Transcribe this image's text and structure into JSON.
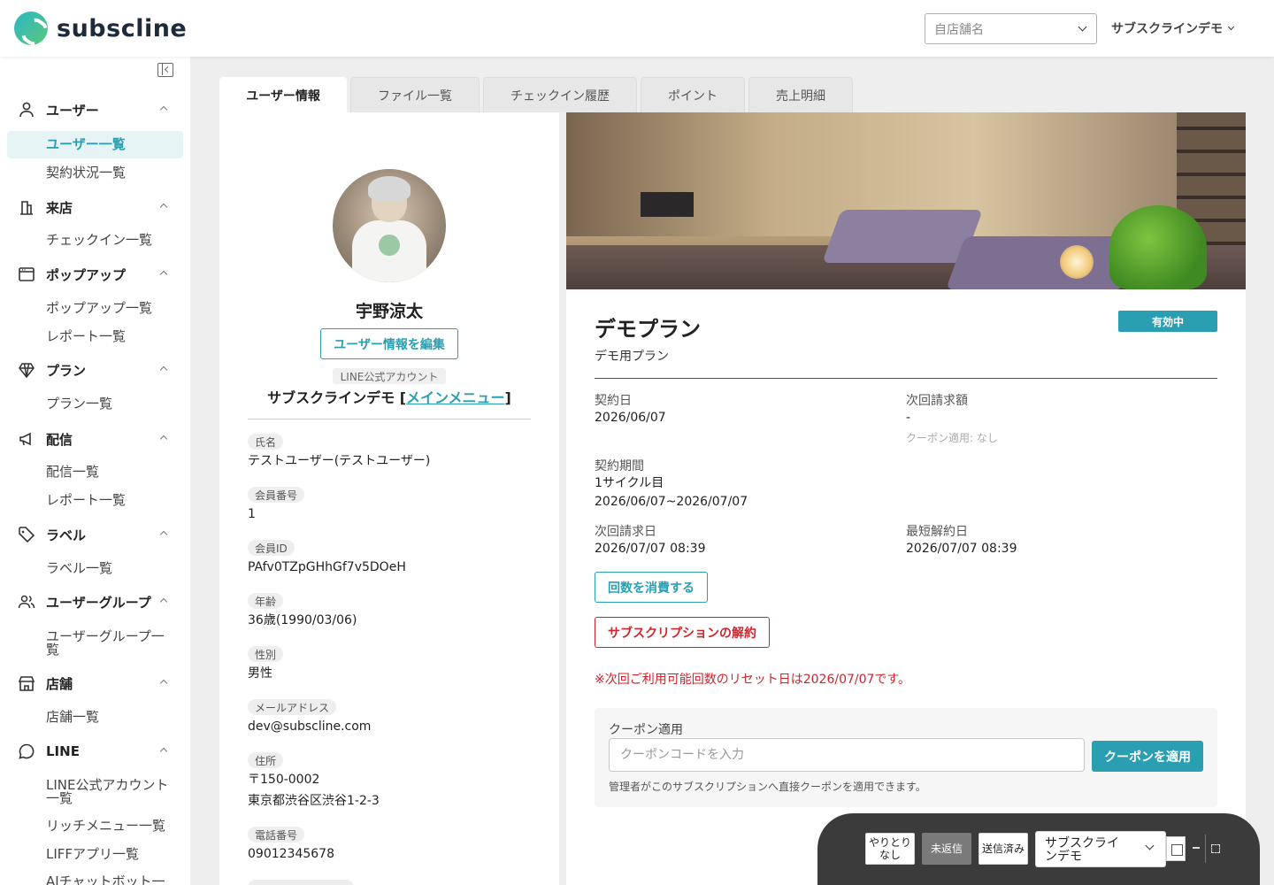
{
  "header": {
    "logo_text": "subscline",
    "store_select_placeholder": "自店舗名",
    "account_name": "サブスクラインデモ"
  },
  "sidebar": {
    "sections": [
      {
        "label": "ユーザー",
        "icon": "user-icon",
        "items": [
          "ユーザー一覧",
          "契約状況一覧"
        ]
      },
      {
        "label": "来店",
        "icon": "building-icon",
        "items": [
          "チェックイン一覧"
        ]
      },
      {
        "label": "ポップアップ",
        "icon": "window-icon",
        "items": [
          "ポップアップ一覧",
          "レポート一覧"
        ]
      },
      {
        "label": "プラン",
        "icon": "diamond-icon",
        "items": [
          "プラン一覧"
        ]
      },
      {
        "label": "配信",
        "icon": "megaphone-icon",
        "items": [
          "配信一覧",
          "レポート一覧"
        ]
      },
      {
        "label": "ラベル",
        "icon": "tag-icon",
        "items": [
          "ラベル一覧"
        ]
      },
      {
        "label": "ユーザーグループ",
        "icon": "users-icon",
        "items": [
          "ユーザーグループ一覧"
        ]
      },
      {
        "label": "店舗",
        "icon": "store-icon",
        "items": [
          "店舗一覧"
        ]
      },
      {
        "label": "LINE",
        "icon": "chat-bubble-icon",
        "items": [
          "LINE公式アカウント一覧",
          "リッチメニュー一覧",
          "LIFFアプリ一覧",
          "AIチャットボット一"
        ]
      }
    ],
    "active_item": "ユーザー一覧"
  },
  "tabs": [
    "ユーザー情報",
    "ファイル一覧",
    "チェックイン履歴",
    "ポイント",
    "売上明細"
  ],
  "profile": {
    "name": "宇野涼太",
    "edit_button": "ユーザー情報を編集",
    "line_label": "LINE公式アカウント",
    "line_account_prefix": "サブスクラインデモ [",
    "line_menu_link": "メインメニュー",
    "line_account_suffix": "]",
    "fields": [
      {
        "label": "氏名",
        "value": "テストユーザー(テストユーザー)"
      },
      {
        "label": "会員番号",
        "value": "1"
      },
      {
        "label": "会員ID",
        "value": "PAfv0TZpGHhGf7v5DOeH"
      },
      {
        "label": "年齢",
        "value": "36歳(1990/03/06)"
      },
      {
        "label": "性別",
        "value": "男性"
      },
      {
        "label": "メールアドレス",
        "value": "dev@subscline.com"
      },
      {
        "label": "住所",
        "value": "〒150-0002",
        "value2": "東京都渋谷区渋谷1-2-3"
      },
      {
        "label": "電話番号",
        "value": "09012345678"
      }
    ]
  },
  "plan": {
    "title": "デモプラン",
    "status": "有効中",
    "subtitle": "デモ用プラン",
    "contract_date_label": "契約日",
    "contract_date": "2026/06/07",
    "next_amount_label": "次回請求額",
    "next_amount": "-",
    "coupon_applied_note": "クーポン適用: なし",
    "period_label": "契約期間",
    "period_cycle": "1サイクル目",
    "period_range": "2026/06/07~2026/07/07",
    "next_billing_label": "次回請求日",
    "next_billing": "2026/07/07 08:39",
    "min_cancel_label": "最短解約日",
    "min_cancel": "2026/07/07 08:39",
    "consume_button": "回数を消費する",
    "cancel_button": "サブスクリプションの解約",
    "reset_note": "※次回ご利用可能回数のリセット日は2026/07/07です。",
    "coupon": {
      "label": "クーポン適用",
      "placeholder": "クーポンコードを入力",
      "button": "クーポンを適用",
      "help": "管理者がこのサブスクリプションへ直接クーポンを適用できます。"
    }
  },
  "chat_widget": {
    "filters": [
      "やりとり\nなし",
      "未返信",
      "送信済み"
    ],
    "selected_filter": "未返信",
    "account_select": "サブスクライ\nンデモ"
  }
}
